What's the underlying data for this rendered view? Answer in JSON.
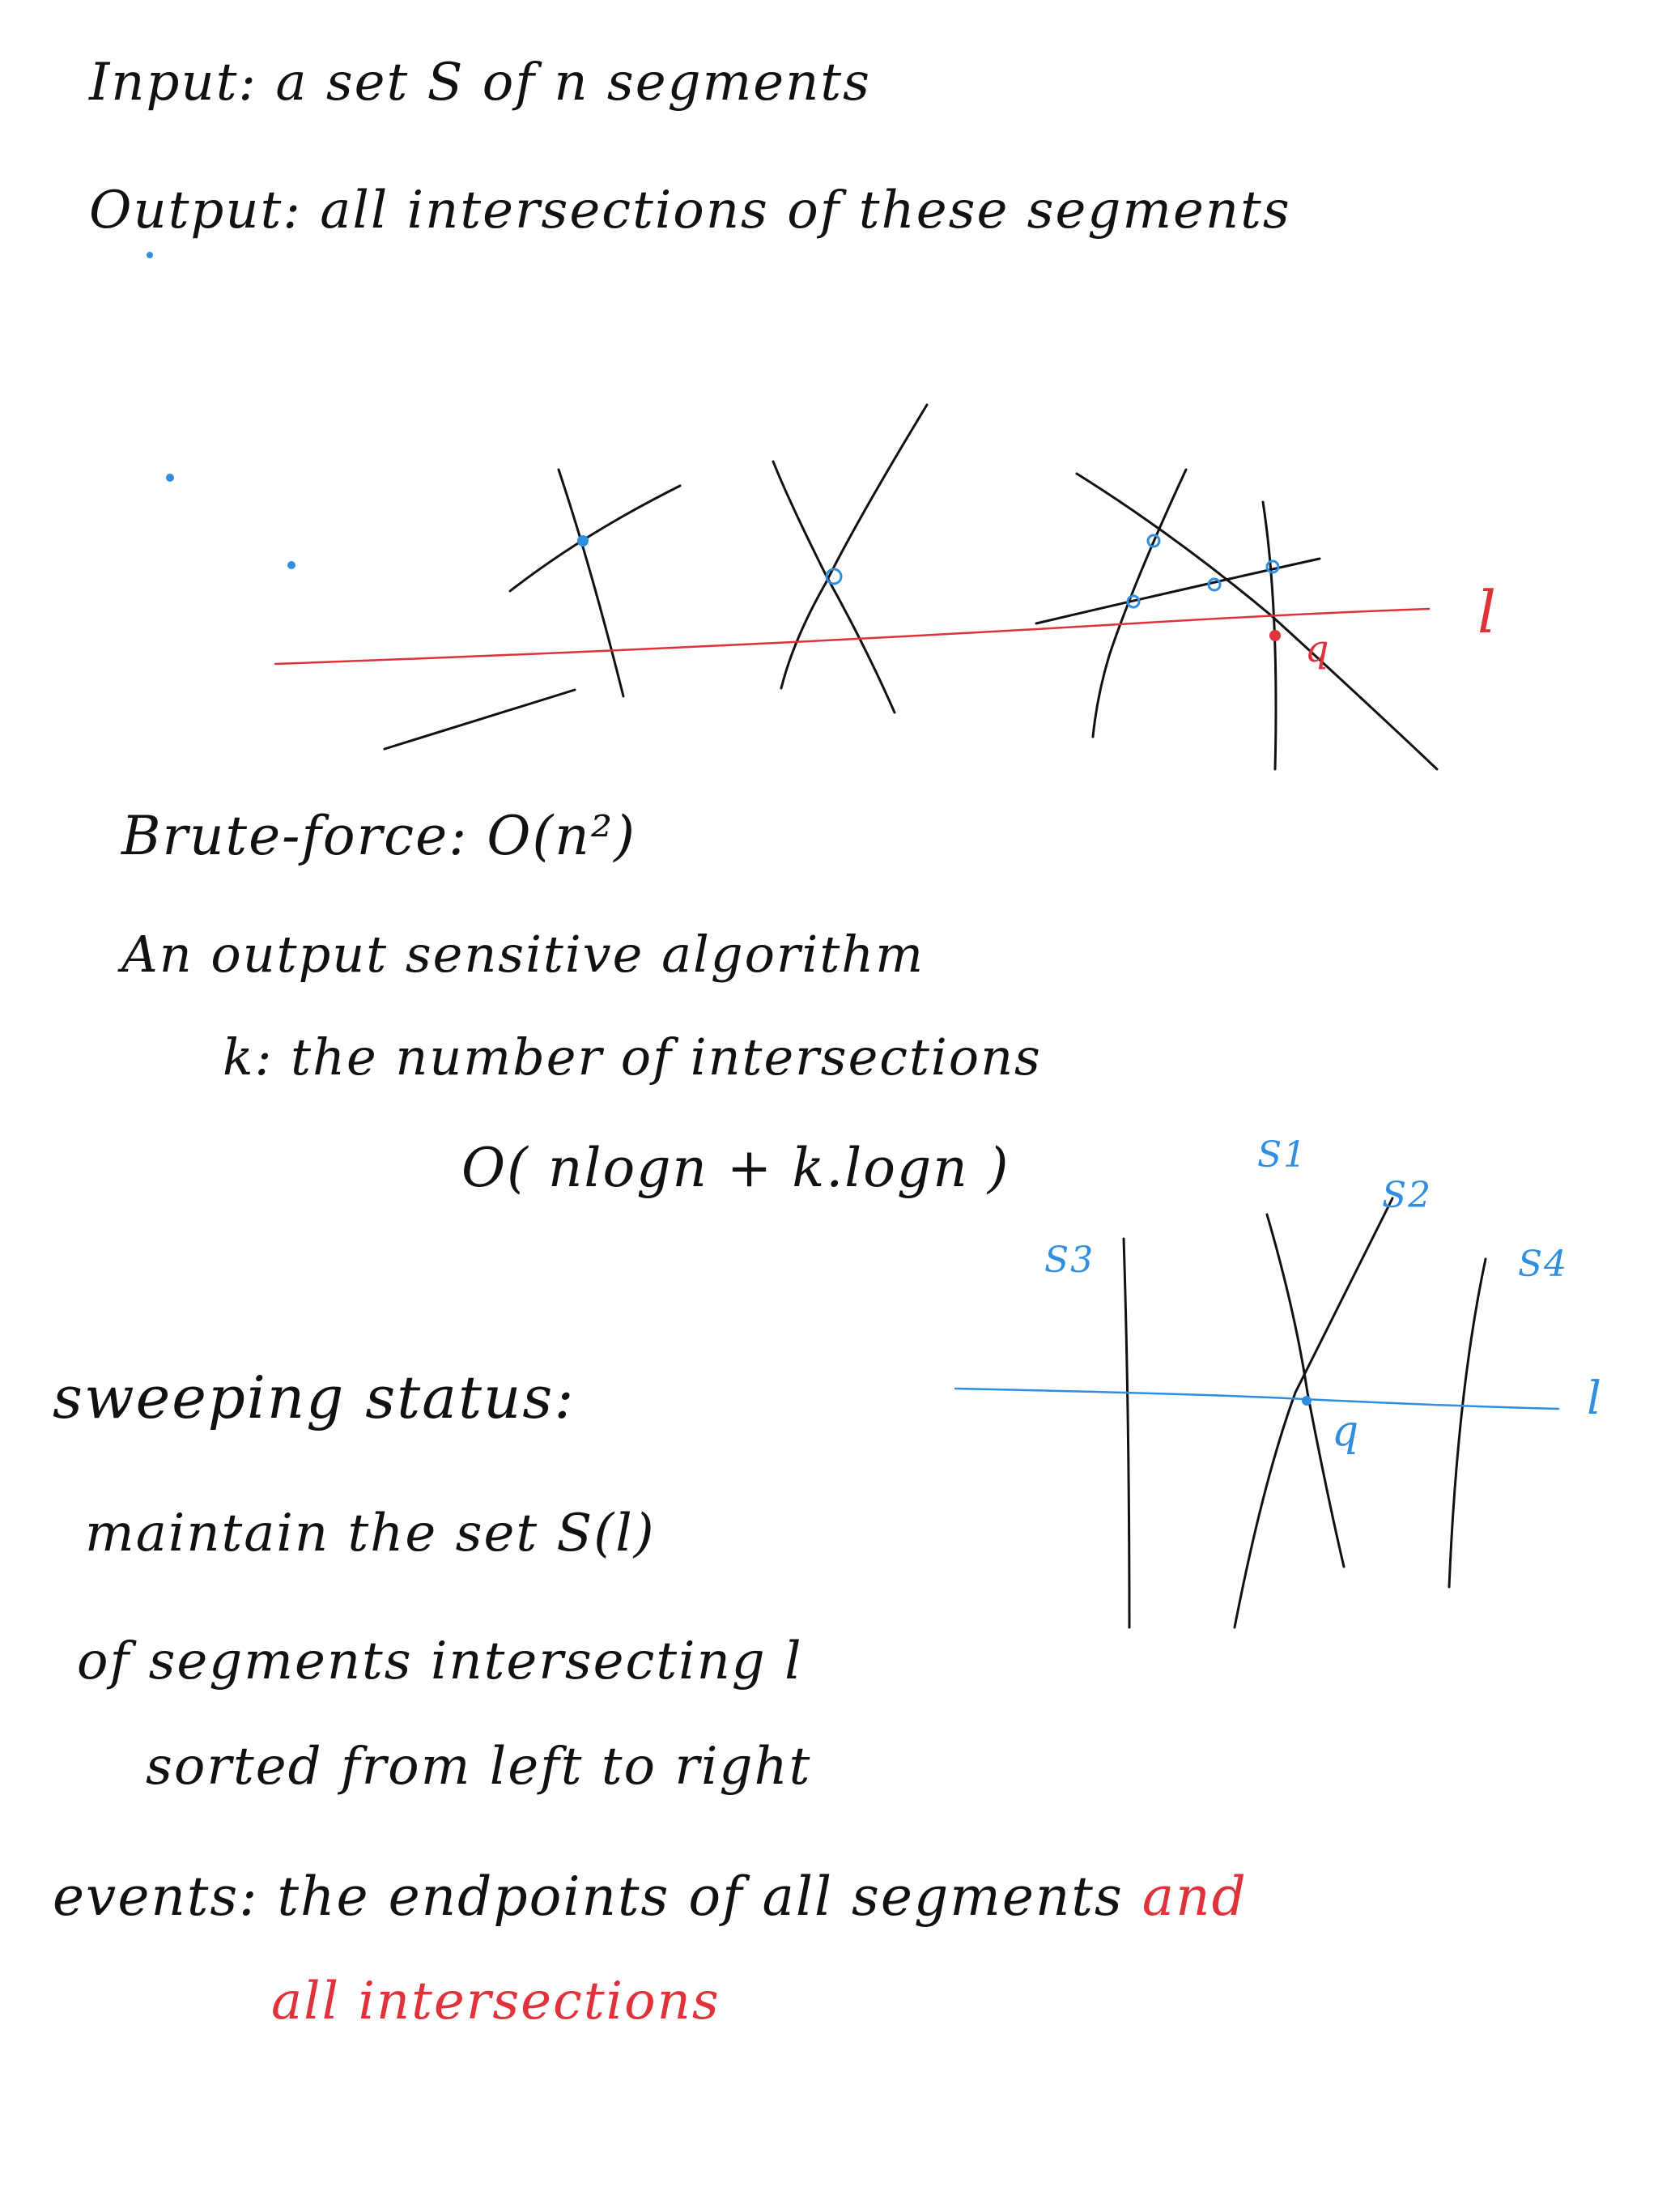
{
  "notes": {
    "input_line": "Input: a set S of n segments",
    "output_line": "Output: all intersections of these segments",
    "brute_force": "Brute-force: O(n²)",
    "output_sensitive": "An output sensitive algorithm",
    "k_definition": "k: the number of intersections",
    "complexity": "O( nlogn + k.logn )",
    "sweeping_status": "sweeping status:",
    "maintain": "maintain the set S(l)",
    "of_segments": "of segments intersecting l",
    "sorted": "sorted from left to right",
    "events": "events: the endpoints of all segments",
    "events_and": "and",
    "events_red": "all intersections"
  },
  "diagram1": {
    "line_label": "l",
    "point_label": "q"
  },
  "diagram2": {
    "s1": "S1",
    "s2": "S2",
    "s3": "S3",
    "s4": "S4",
    "line_label": "l",
    "point_label": "q"
  },
  "colors": {
    "ink": "#111111",
    "red": "#e0323a",
    "blue": "#2f8ee0"
  }
}
